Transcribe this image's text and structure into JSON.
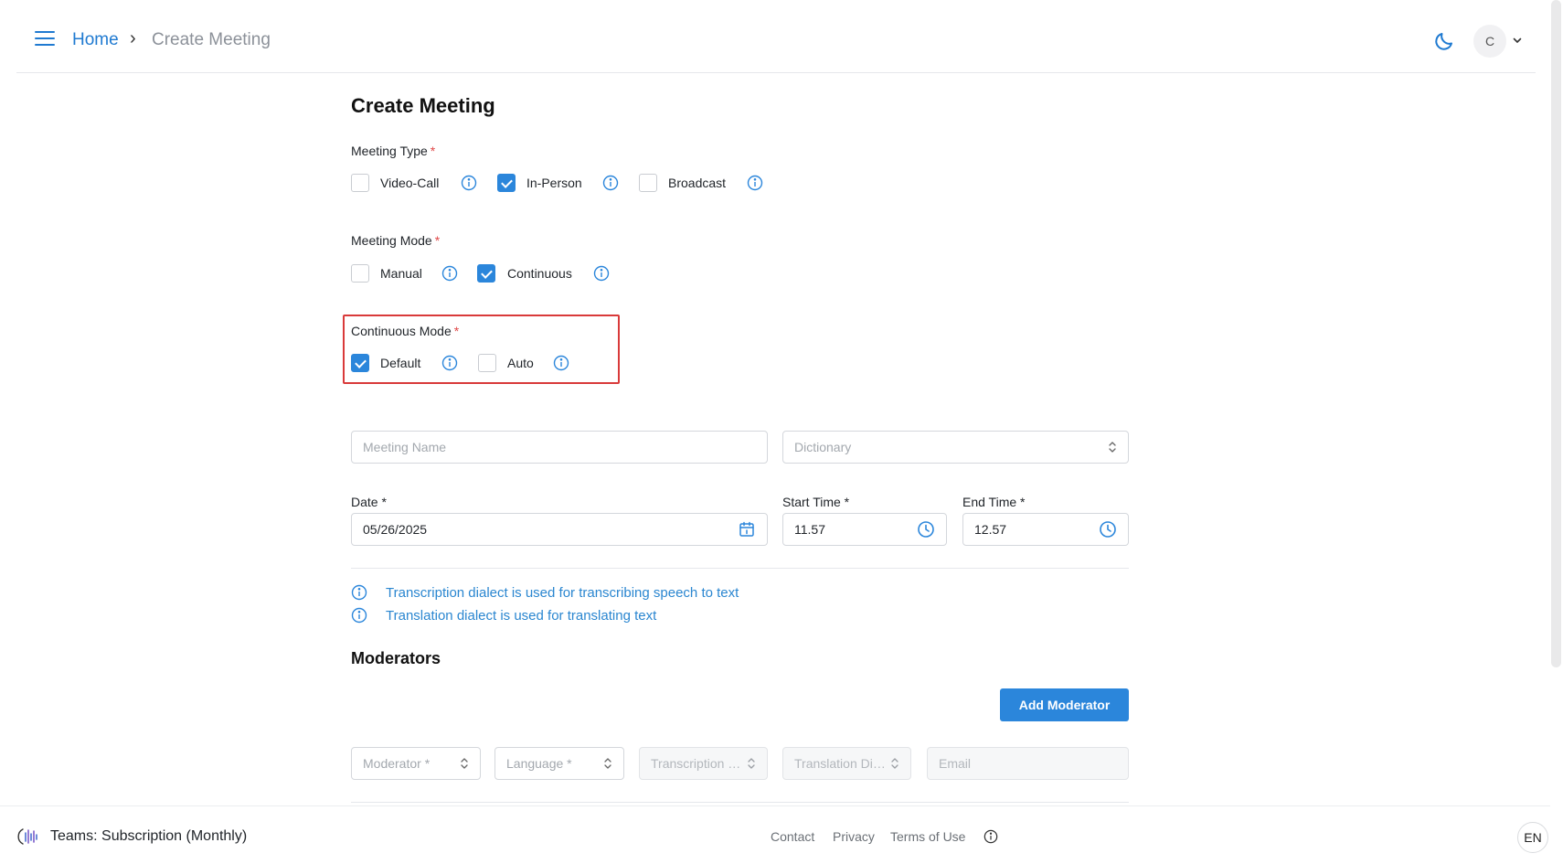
{
  "header": {
    "home_label": "Home",
    "separator": "›",
    "current_label": "Create Meeting",
    "avatar_initial": "C"
  },
  "page": {
    "title": "Create Meeting"
  },
  "meeting_type": {
    "label": "Meeting Type",
    "required_mark": "*",
    "options": [
      {
        "label": "Video-Call",
        "checked": false
      },
      {
        "label": "In-Person",
        "checked": true
      },
      {
        "label": "Broadcast",
        "checked": false
      }
    ]
  },
  "meeting_mode": {
    "label": "Meeting Mode",
    "required_mark": "*",
    "options": [
      {
        "label": "Manual",
        "checked": false
      },
      {
        "label": "Continuous",
        "checked": true
      }
    ]
  },
  "continuous_mode": {
    "label": "Continuous Mode",
    "required_mark": "*",
    "options": [
      {
        "label": "Default",
        "checked": true
      },
      {
        "label": "Auto",
        "checked": false
      }
    ]
  },
  "form": {
    "meeting_name_placeholder": "Meeting Name",
    "dictionary_placeholder": "Dictionary",
    "date_label": "Date *",
    "date_value": "05/26/2025",
    "start_time_label": "Start Time *",
    "start_time_value": "11.57",
    "end_time_label": "End Time *",
    "end_time_value": "12.57"
  },
  "notes": [
    "Transcription dialect is used for transcribing speech to text",
    "Translation dialect is used for translating text"
  ],
  "moderators": {
    "title": "Moderators",
    "add_button": "Add Moderator",
    "moderator_placeholder": "Moderator *",
    "language_placeholder": "Language *",
    "transcription_placeholder": "Transcription D...",
    "translation_placeholder": "Translation Dial...",
    "email_placeholder": "Email"
  },
  "footer": {
    "team_text": "Teams: Subscription (Monthly)",
    "links": [
      "Contact",
      "Privacy",
      "Terms of Use"
    ],
    "language": "EN"
  },
  "colors": {
    "accent": "#2b86db",
    "link": "#1f7ad1",
    "highlight_border": "#d93a3a",
    "required": "#e04848"
  },
  "icons": {
    "menu": "hamburger-menu-icon",
    "theme": "moon-icon",
    "info": "info-circle-icon",
    "calendar": "calendar-icon",
    "clock": "clock-icon",
    "select": "select-arrows-icon"
  }
}
